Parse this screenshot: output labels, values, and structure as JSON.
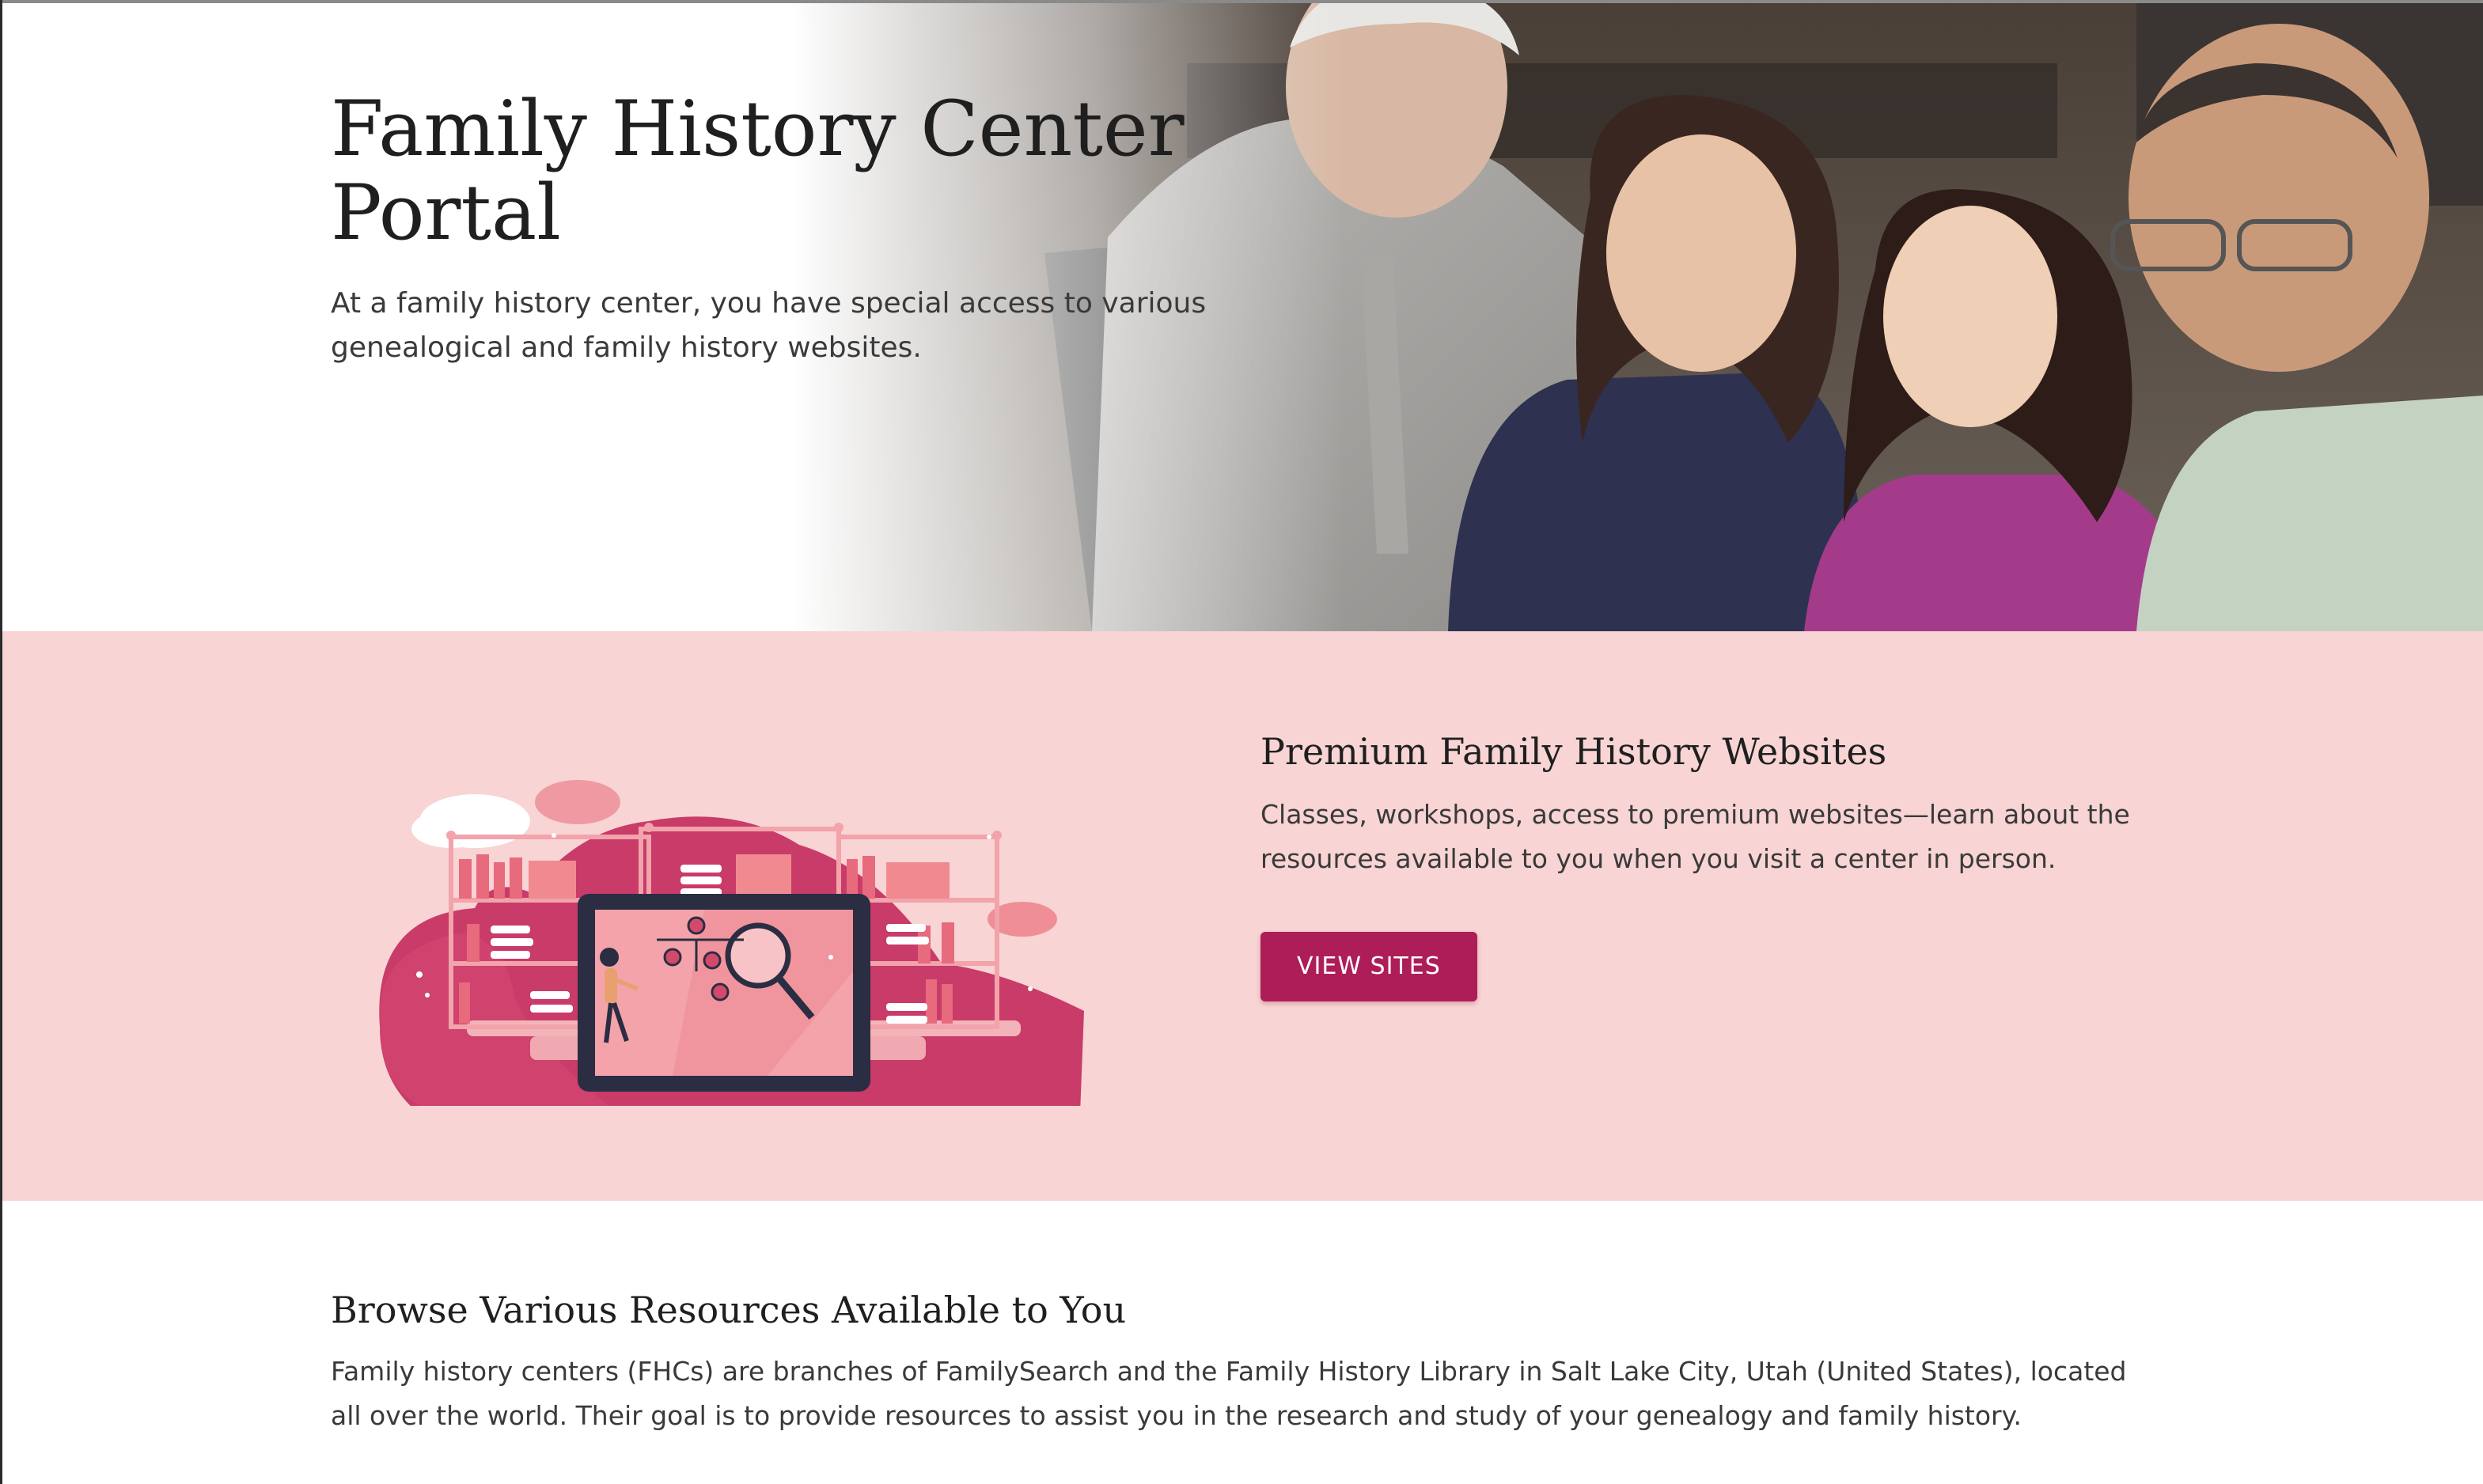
{
  "hero": {
    "title_line1": "Family History Center",
    "title_line2": "Portal",
    "subtitle": "At a family history center, you have special access to various genealogical and family history websites."
  },
  "premium": {
    "title": "Premium Family History Websites",
    "description": "Classes, workshops, access to premium websites—learn about the resources available to you when you visit a center in person.",
    "button_label": "VIEW SITES"
  },
  "browse": {
    "title": "Browse Various Resources Available to You",
    "description": "Family history centers (FHCs) are branches of FamilySearch and the Family History Library in Salt Lake City, Utah (United States), located all over the world. Their goal is to provide resources to assist you in the research and study of your genealogy and family history."
  },
  "colors": {
    "band_background": "#f8d4d4",
    "button_background": "#ad1d57",
    "illustration_primary": "#c93b68",
    "illustration_secondary": "#ee9aa3"
  }
}
